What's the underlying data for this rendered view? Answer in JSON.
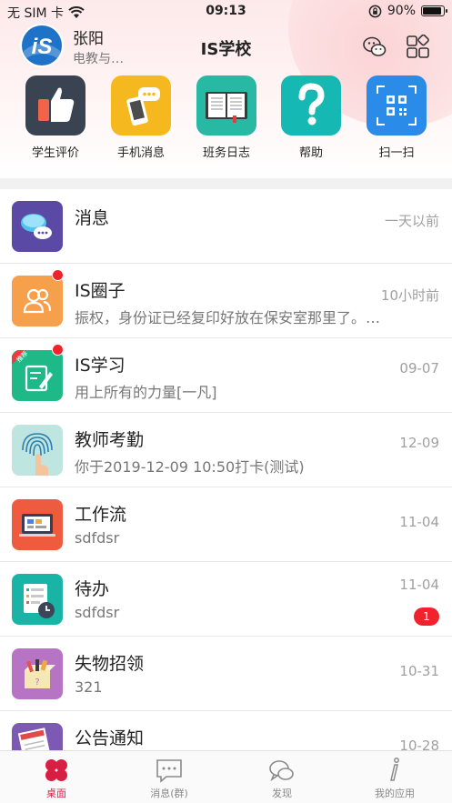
{
  "status_bar": {
    "carrier": "无 SIM 卡",
    "time": "09:13",
    "battery": "90%",
    "battery_level": 0.9
  },
  "header": {
    "user_name": "张阳",
    "user_sub": "电教与…",
    "title": "IS学校",
    "avatar_text": "iS"
  },
  "quick_actions": [
    {
      "label": "学生评价",
      "icon": "thumbs-up-icon",
      "color": "#3a4352"
    },
    {
      "label": "手机消息",
      "icon": "phone-message-icon",
      "color": "#f6b81f"
    },
    {
      "label": "班务日志",
      "icon": "book-icon",
      "color": "#27b9a4"
    },
    {
      "label": "帮助",
      "icon": "help-icon",
      "color": "#16b8b4"
    },
    {
      "label": "扫一扫",
      "icon": "qr-scan-icon",
      "color": "#2a8be8"
    }
  ],
  "list": [
    {
      "title": "消息",
      "subtitle": "",
      "time": "一天以前",
      "icon": "chat-bubbles-icon",
      "color": "#5b4aa5"
    },
    {
      "title": "IS圈子",
      "subtitle": "振权，身份证已经复印好放在保安室那里了。…",
      "time": "10小时前",
      "icon": "people-icon",
      "color": "#f7a04b"
    },
    {
      "title": "IS学习",
      "subtitle": "用上所有的力量[一凡]",
      "time": "09-07",
      "icon": "learning-icon",
      "color": "#1fb887",
      "ribbon": "推荐"
    },
    {
      "title": "教师考勤",
      "subtitle": "你于2019-12-09 10:50打卡(测试)",
      "time": "12-09",
      "icon": "fingerprint-icon",
      "color": "#bfe5e0"
    },
    {
      "title": "工作流",
      "subtitle": "sdfdsr",
      "time": "11-04",
      "icon": "workflow-icon",
      "color": "#ef5b3f"
    },
    {
      "title": "待办",
      "subtitle": "sdfdsr",
      "time": "11-04",
      "icon": "todo-icon",
      "color": "#1ab4a7",
      "badge": "1"
    },
    {
      "title": "失物招领",
      "subtitle": "321",
      "time": "10-31",
      "icon": "lost-found-icon",
      "color": "#b874c4"
    },
    {
      "title": "公告通知",
      "subtitle": "",
      "time": "10-28",
      "icon": "news-icon",
      "color": "#7c59b3"
    }
  ],
  "tabbar": [
    {
      "label": "桌面",
      "icon": "desktop-icon",
      "active": true
    },
    {
      "label": "消息(群)",
      "icon": "message-group-icon",
      "active": false
    },
    {
      "label": "发现",
      "icon": "discover-icon",
      "active": false
    },
    {
      "label": "我的应用",
      "icon": "my-apps-icon",
      "active": false
    }
  ],
  "accent_color": "#d81e43"
}
